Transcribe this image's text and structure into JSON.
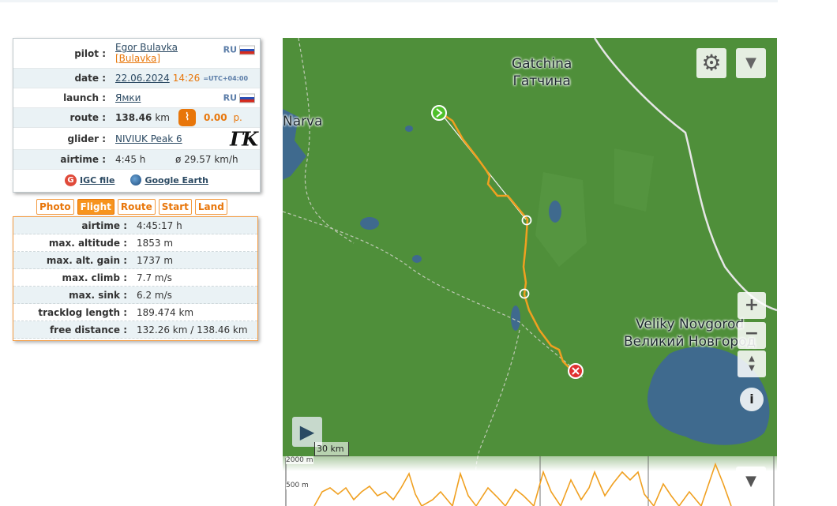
{
  "info": {
    "pilot_label": "pilot :",
    "pilot_name": "Egor Bulavka",
    "pilot_nick": "[Bulavka]",
    "pilot_country": "RU",
    "date_label": "date :",
    "date_value": "22.06.2024",
    "time_value": "14:26",
    "timezone": "=UTC+04:00",
    "launch_label": "launch :",
    "launch_value": "Ямки",
    "launch_country": "RU",
    "route_label": "route :",
    "route_distance": "138.46",
    "route_unit": "km",
    "route_points": "0.00",
    "route_points_unit": "p.",
    "glider_label": "glider :",
    "glider_value": "NIVIUK Peak 6",
    "airtime_label": "airtime :",
    "airtime_value": "4:45 h",
    "avg_speed": "ø 29.57 km/h",
    "igc_label": "IGC file",
    "ge_label": "Google Earth"
  },
  "tabs": [
    {
      "label": "Photo",
      "active": false
    },
    {
      "label": "Flight",
      "active": true
    },
    {
      "label": "Route",
      "active": false
    },
    {
      "label": "Start",
      "active": false
    },
    {
      "label": "Land",
      "active": false
    }
  ],
  "stats": [
    {
      "label": "airtime :",
      "value": "4:45:17 h"
    },
    {
      "label": "max. altitude :",
      "value": "1853 m"
    },
    {
      "label": "max. alt. gain :",
      "value": "1737 m"
    },
    {
      "label": "max. climb :",
      "value": "7.7 m/s"
    },
    {
      "label": "max. sink :",
      "value": "6.2 m/s"
    },
    {
      "label": "tracklog length :",
      "value": "189.474 km"
    },
    {
      "label": "free distance :",
      "value": "132.26 km / 138.46 km"
    }
  ],
  "map": {
    "labels": {
      "gatchina_en": "Gatchina",
      "gatchina_ru": "Гатчина",
      "narva": "Narva",
      "novgorod_en": "Veliky Novgorod",
      "novgorod_ru": "Великий Новгород"
    },
    "scale": "30 km",
    "controls": {
      "gear": "⚙",
      "down": "▼",
      "zoom_in": "+",
      "zoom_out": "−",
      "info": "i",
      "play": "▶"
    },
    "colors": {
      "land": "#4f8f3a",
      "water": "#3f6a8e",
      "track": "#f0a020",
      "start": "#4fc02a",
      "finish": "#e03030"
    }
  },
  "graph": {
    "label_top": "2000 m",
    "label_mid": "500 m"
  }
}
